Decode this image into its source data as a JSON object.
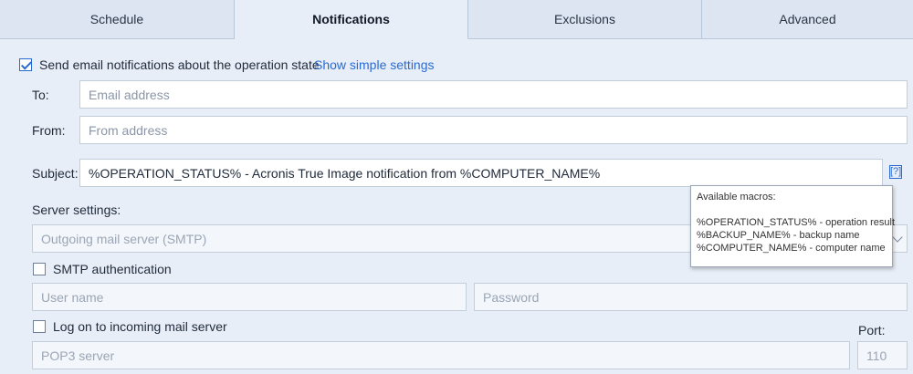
{
  "tabs": [
    {
      "label": "Schedule",
      "active": false
    },
    {
      "label": "Notifications",
      "active": true
    },
    {
      "label": "Exclusions",
      "active": false
    },
    {
      "label": "Advanced",
      "active": false
    }
  ],
  "email": {
    "enabled": true,
    "enable_label": "Send email notifications about the operation state",
    "simple_link": "Show simple settings"
  },
  "to": {
    "label": "To:",
    "placeholder": "Email address",
    "value": ""
  },
  "from": {
    "label": "From:",
    "placeholder": "From address",
    "value": ""
  },
  "subject": {
    "label": "Subject:",
    "value": "%OPERATION_STATUS% - Acronis True Image notification from %COMPUTER_NAME%",
    "help_label": "[?]"
  },
  "tooltip": {
    "title": "Available macros:",
    "lines": [
      "%OPERATION_STATUS% - operation result",
      "%BACKUP_NAME% - backup name",
      "%COMPUTER_NAME% - computer name"
    ]
  },
  "server": {
    "label": "Server settings:",
    "outgoing_placeholder": "Outgoing mail server (SMTP)"
  },
  "smtp_auth": {
    "checked": false,
    "label": "SMTP authentication",
    "username_placeholder": "User name",
    "password_placeholder": "Password"
  },
  "incoming": {
    "checked": false,
    "label": "Log on to incoming mail server",
    "pop3_placeholder": "POP3 server",
    "port_label": "Port:",
    "port_value": "110"
  },
  "colors": {
    "accent": "#2a6bd0",
    "background": "#e8eef7"
  }
}
